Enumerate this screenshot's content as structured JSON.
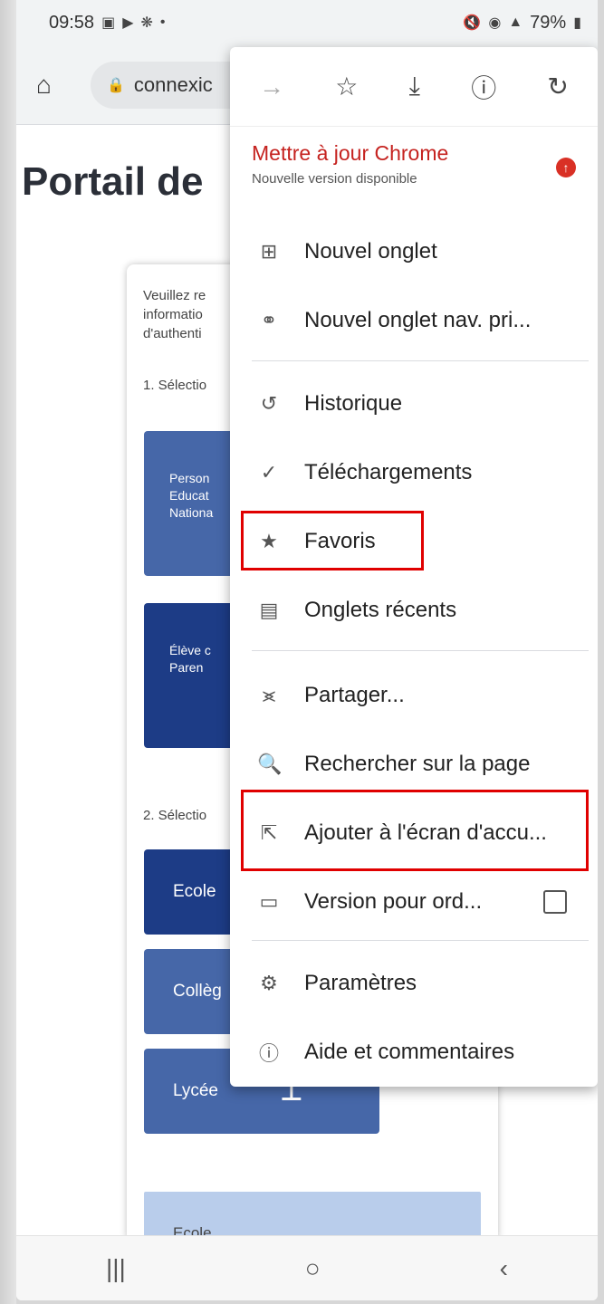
{
  "status_bar": {
    "time": "09:58",
    "left_icons": [
      "image-icon",
      "play-icon",
      "gear-icon",
      "dot-icon"
    ],
    "battery": "79%"
  },
  "url_bar": {
    "url_text": "connexic"
  },
  "page": {
    "title": "Portail de",
    "intro_lines": [
      "Veuillez re",
      "informatio",
      "d'authenti"
    ],
    "step1": "1. Sélectio",
    "step2": "2. Sélectio",
    "tile1_lines": [
      "Person",
      "Educat",
      "Nationa"
    ],
    "tile2_lines": [
      "Élève c",
      "Paren"
    ],
    "levels": [
      "Ecole",
      "Collèg",
      "Lycée"
    ],
    "bottom_panel": "Ecole"
  },
  "menu": {
    "update_title": "Mettre à jour Chrome",
    "update_subtitle": "Nouvelle version disponible",
    "items": [
      {
        "label": "Nouvel onglet",
        "icon": "plus-box-icon"
      },
      {
        "label": "Nouvel onglet nav. pri...",
        "icon": "incognito-icon"
      },
      {
        "label": "Historique",
        "icon": "history-icon"
      },
      {
        "label": "Téléchargements",
        "icon": "download-check-icon"
      },
      {
        "label": "Favoris",
        "icon": "star-icon"
      },
      {
        "label": "Onglets récents",
        "icon": "devices-icon"
      },
      {
        "label": "Partager...",
        "icon": "share-icon"
      },
      {
        "label": "Rechercher sur la page",
        "icon": "find-in-page-icon"
      },
      {
        "label": "Ajouter à l'écran d'accu...",
        "icon": "add-to-home-icon"
      },
      {
        "label": "Version pour ord...",
        "icon": "desktop-icon"
      },
      {
        "label": "Paramètres",
        "icon": "gear-icon"
      },
      {
        "label": "Aide et commentaires",
        "icon": "help-icon"
      }
    ]
  },
  "colors": {
    "highlight": "#e00000",
    "update_red": "#c5221f",
    "tile_blue": "#4667a8",
    "tile_dark_blue": "#1d3c86"
  }
}
